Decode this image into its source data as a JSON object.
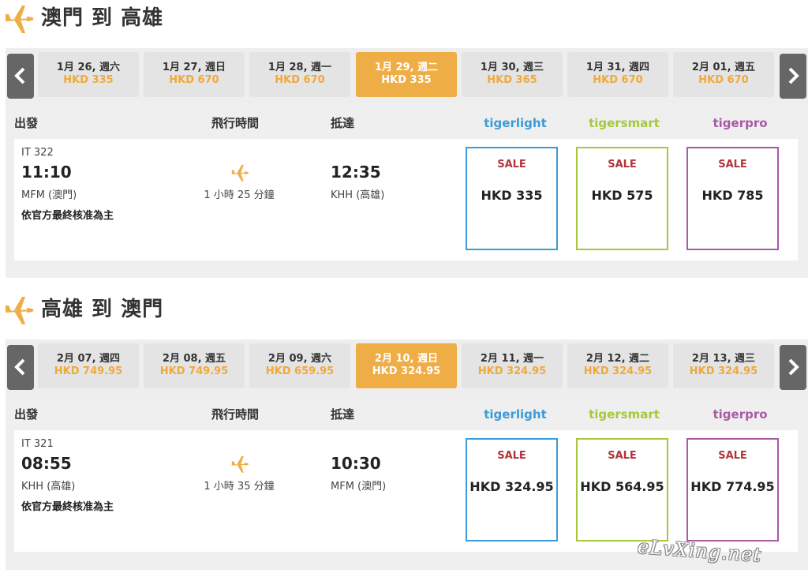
{
  "colors": {
    "accent": "#efad45",
    "price": "#f0a93b",
    "tigerlight": "#3b9bd8",
    "tigersmart": "#a6c93b",
    "tigerpro": "#a959a6",
    "sale": "#b0343a"
  },
  "legs": [
    {
      "title": "澳門 到 高雄",
      "dates": [
        {
          "date": "1月 26, 週六",
          "price": "HKD 335"
        },
        {
          "date": "1月 27, 週日",
          "price": "HKD 670"
        },
        {
          "date": "1月 28, 週一",
          "price": "HKD 670"
        },
        {
          "date": "1月 29, 週二",
          "price": "HKD 335"
        },
        {
          "date": "1月 30, 週三",
          "price": "HKD 365"
        },
        {
          "date": "1月 31, 週四",
          "price": "HKD 670"
        },
        {
          "date": "2月 01, 週五",
          "price": "HKD 670"
        }
      ],
      "headers": {
        "depart": "出發",
        "duration": "飛行時間",
        "arrive": "抵達"
      },
      "brands": {
        "light": "tigerlight",
        "smart": "tigersmart",
        "pro": "tigerpro"
      },
      "flight": {
        "number": "IT 322",
        "dep_time": "11:10",
        "dep_airport": "MFM (澳門)",
        "duration": "1 小時 25 分鐘",
        "arr_time": "12:35",
        "arr_airport": "KHH (高雄)",
        "note": "依官方最終核准為主"
      },
      "fares": [
        {
          "tag": "SALE",
          "price": "HKD 335"
        },
        {
          "tag": "SALE",
          "price": "HKD 575"
        },
        {
          "tag": "SALE",
          "price": "HKD 785"
        }
      ]
    },
    {
      "title": "高雄 到 澳門",
      "dates": [
        {
          "date": "2月 07, 週四",
          "price": "HKD 749.95"
        },
        {
          "date": "2月 08, 週五",
          "price": "HKD 749.95"
        },
        {
          "date": "2月 09, 週六",
          "price": "HKD 659.95"
        },
        {
          "date": "2月 10, 週日",
          "price": "HKD 324.95"
        },
        {
          "date": "2月 11, 週一",
          "price": "HKD 324.95"
        },
        {
          "date": "2月 12, 週二",
          "price": "HKD 324.95"
        },
        {
          "date": "2月 13, 週三",
          "price": "HKD 324.95"
        }
      ],
      "headers": {
        "depart": "出發",
        "duration": "飛行時間",
        "arrive": "抵達"
      },
      "brands": {
        "light": "tigerlight",
        "smart": "tigersmart",
        "pro": "tigerpro"
      },
      "flight": {
        "number": "IT 321",
        "dep_time": "08:55",
        "dep_airport": "KHH (高雄)",
        "duration": "1 小時 35 分鐘",
        "arr_time": "10:30",
        "arr_airport": "MFM (澳門)",
        "note": "依官方最終核准為主"
      },
      "fares": [
        {
          "tag": "SALE",
          "price": "HKD 324.95"
        },
        {
          "tag": "SALE",
          "price": "HKD 564.95"
        },
        {
          "tag": "SALE",
          "price": "HKD 774.95"
        }
      ]
    }
  ],
  "watermark": "eLvXing.net"
}
